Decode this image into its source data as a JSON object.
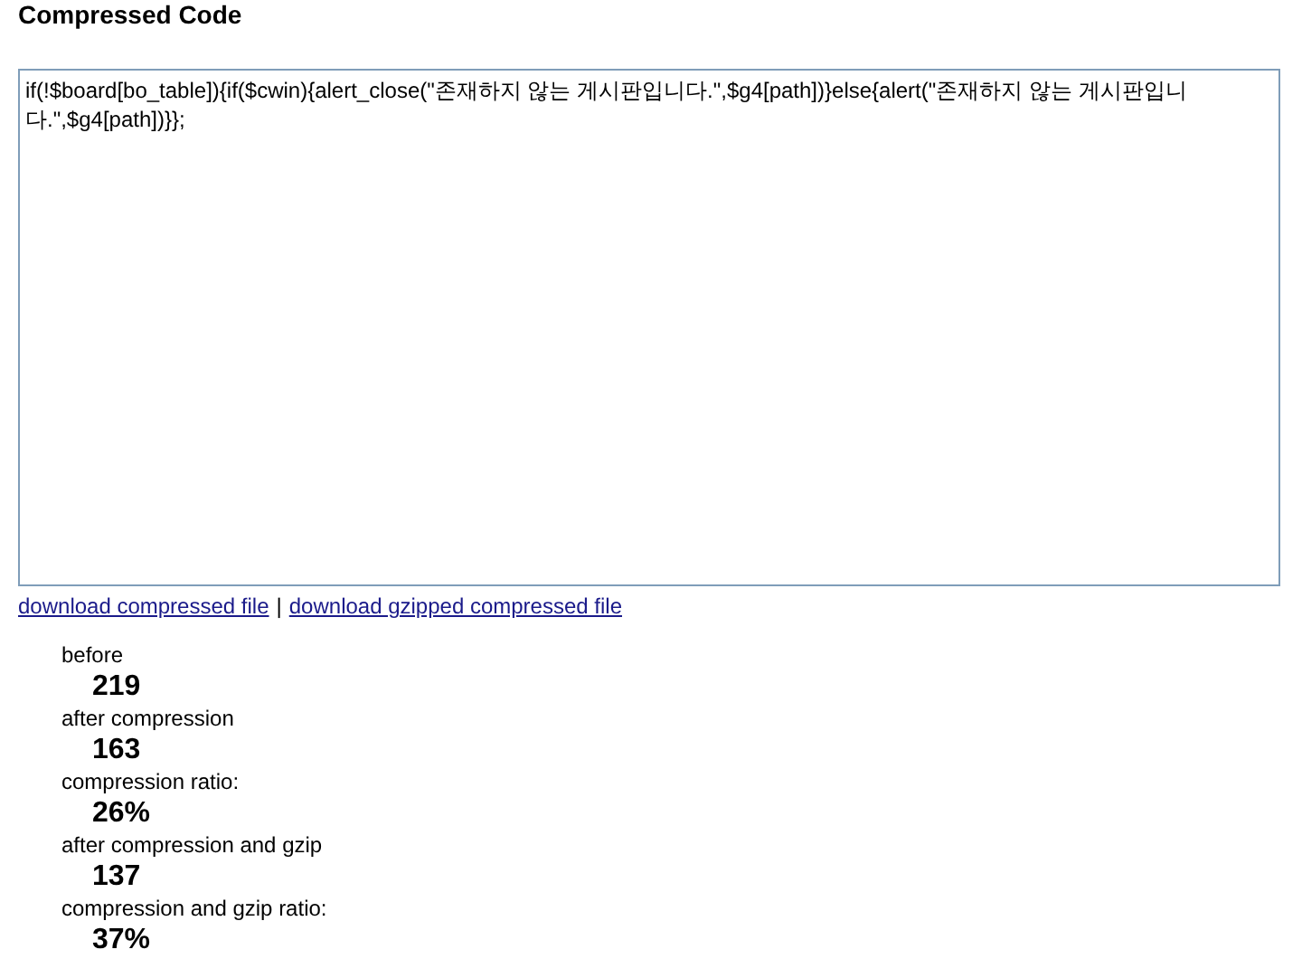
{
  "title": "Compressed Code",
  "code": "if(!$board[bo_table]){if($cwin){alert_close(\"존재하지 않는 게시판입니다.\",$g4[path])}else{alert(\"존재하지 않는 게시판입니다.\",$g4[path])}};",
  "links": [
    {
      "label": "download compressed file"
    },
    {
      "label": "download gzipped compressed file"
    }
  ],
  "separator": "|",
  "stats": [
    {
      "label": "before",
      "value": "219"
    },
    {
      "label": "after compression",
      "value": "163"
    },
    {
      "label": "compression ratio:",
      "value": "26%"
    },
    {
      "label": "after compression and gzip",
      "value": "137"
    },
    {
      "label": "compression and gzip ratio:",
      "value": "37%"
    }
  ]
}
